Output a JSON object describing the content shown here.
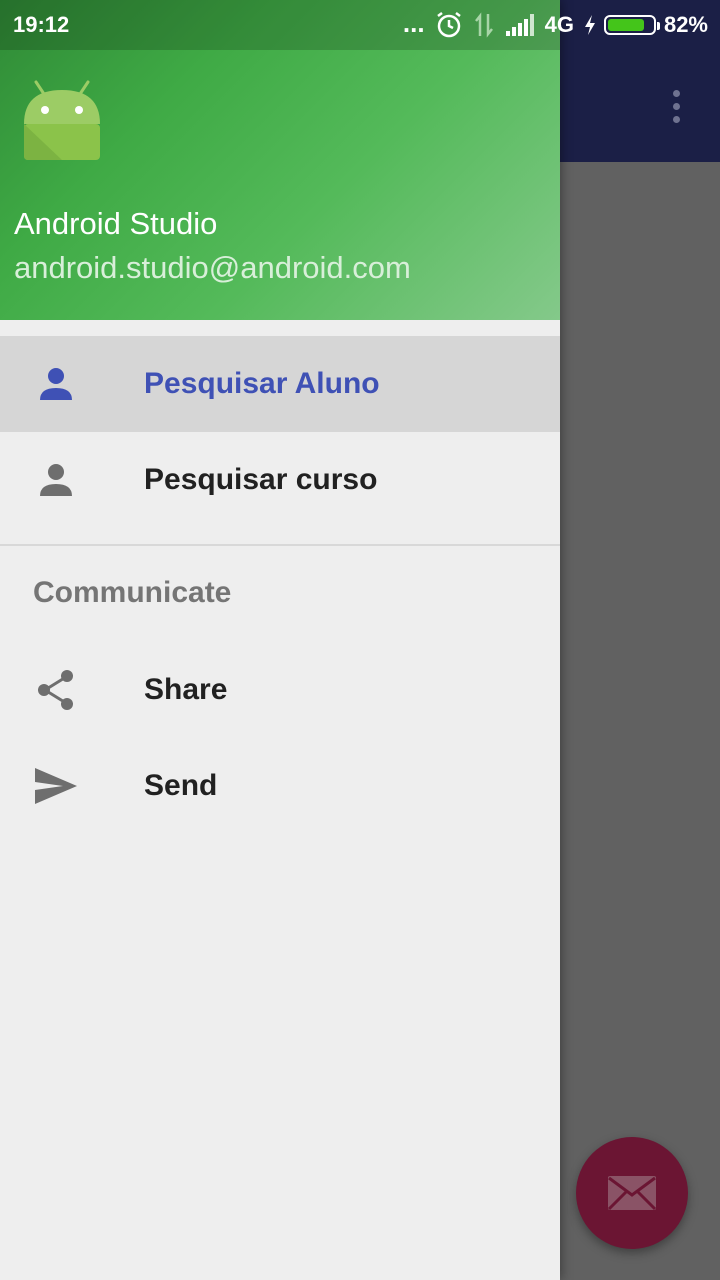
{
  "status_bar": {
    "time": "19:12",
    "notification_dots": "...",
    "network": "4G",
    "battery_percent": "82%",
    "battery_level": 0.82
  },
  "drawer": {
    "header": {
      "name": "Android Studio",
      "email": "android.studio@android.com",
      "logo_icon": "android-robot-icon"
    },
    "items": [
      {
        "label": "Pesquisar Aluno",
        "icon": "person-icon",
        "selected": true
      },
      {
        "label": "Pesquisar curso",
        "icon": "person-icon",
        "selected": false
      }
    ],
    "section": {
      "title": "Communicate",
      "items": [
        {
          "label": "Share",
          "icon": "share-icon"
        },
        {
          "label": "Send",
          "icon": "send-icon"
        }
      ]
    }
  },
  "app": {
    "overflow_icon": "more-vert-icon",
    "fab_icon": "email-icon"
  },
  "colors": {
    "selected_text": "#3f51b5",
    "header_green": "#4caf50",
    "app_bar": "#1b1f46",
    "fab": "#6b1533"
  }
}
